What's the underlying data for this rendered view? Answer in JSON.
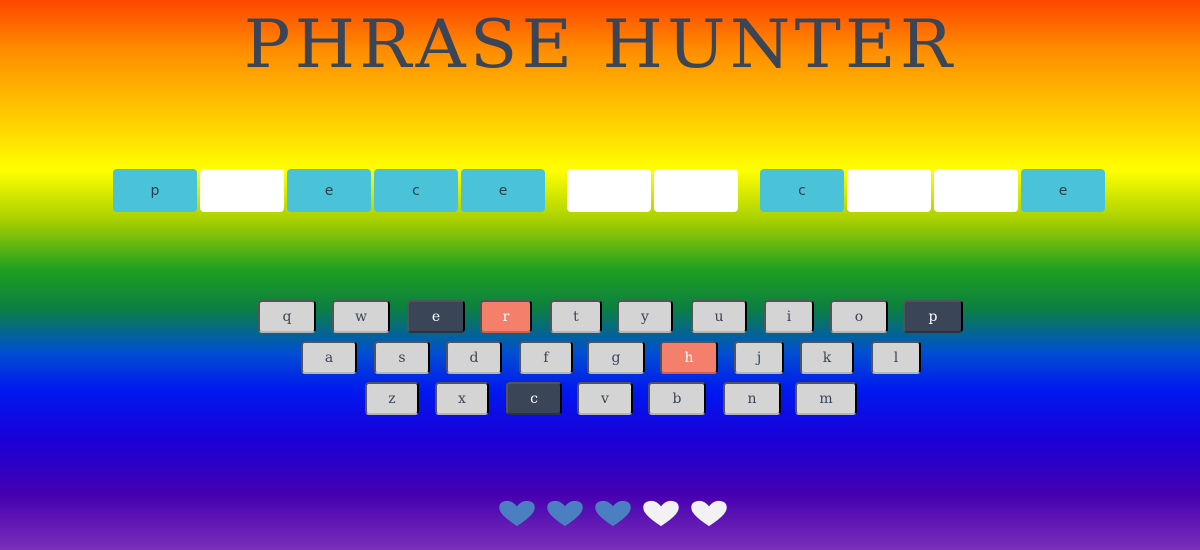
{
  "title": "PHRASE HUNTER",
  "phrase": {
    "words": [
      [
        {
          "letter": "p",
          "shown": true
        },
        {
          "letter": "",
          "shown": false
        },
        {
          "letter": "e",
          "shown": true
        },
        {
          "letter": "c",
          "shown": true
        },
        {
          "letter": "e",
          "shown": true
        }
      ],
      [
        {
          "letter": "",
          "shown": false
        },
        {
          "letter": "",
          "shown": false
        }
      ],
      [
        {
          "letter": "c",
          "shown": true
        },
        {
          "letter": "",
          "shown": false
        },
        {
          "letter": "",
          "shown": false
        },
        {
          "letter": "e",
          "shown": true
        }
      ]
    ]
  },
  "keyboard": {
    "rows": [
      [
        {
          "label": "q",
          "state": "default"
        },
        {
          "label": "w",
          "state": "default"
        },
        {
          "label": "e",
          "state": "chosen"
        },
        {
          "label": "r",
          "state": "wrong"
        },
        {
          "label": "t",
          "state": "default"
        },
        {
          "label": "y",
          "state": "default"
        },
        {
          "label": "u",
          "state": "default"
        },
        {
          "label": "i",
          "state": "default"
        },
        {
          "label": "o",
          "state": "default"
        },
        {
          "label": "p",
          "state": "chosen"
        }
      ],
      [
        {
          "label": "a",
          "state": "default"
        },
        {
          "label": "s",
          "state": "default"
        },
        {
          "label": "d",
          "state": "default"
        },
        {
          "label": "f",
          "state": "default"
        },
        {
          "label": "g",
          "state": "default"
        },
        {
          "label": "h",
          "state": "wrong"
        },
        {
          "label": "j",
          "state": "default"
        },
        {
          "label": "k",
          "state": "default"
        },
        {
          "label": "l",
          "state": "default"
        }
      ],
      [
        {
          "label": "z",
          "state": "default"
        },
        {
          "label": "x",
          "state": "default"
        },
        {
          "label": "c",
          "state": "chosen"
        },
        {
          "label": "v",
          "state": "default"
        },
        {
          "label": "b",
          "state": "default"
        },
        {
          "label": "n",
          "state": "default"
        },
        {
          "label": "m",
          "state": "default"
        }
      ]
    ]
  },
  "lives": {
    "total": 5,
    "remaining": 3,
    "live_color": "#4a7fc1",
    "lost_color": "#f2f2f2"
  },
  "colors": {
    "tile_shown": "#4ac3d8",
    "tile_hidden": "#ffffff",
    "key_default": "#d4d4d4",
    "key_chosen": "#3b4558",
    "key_wrong": "#f47f6b",
    "title": "#3b4558"
  }
}
